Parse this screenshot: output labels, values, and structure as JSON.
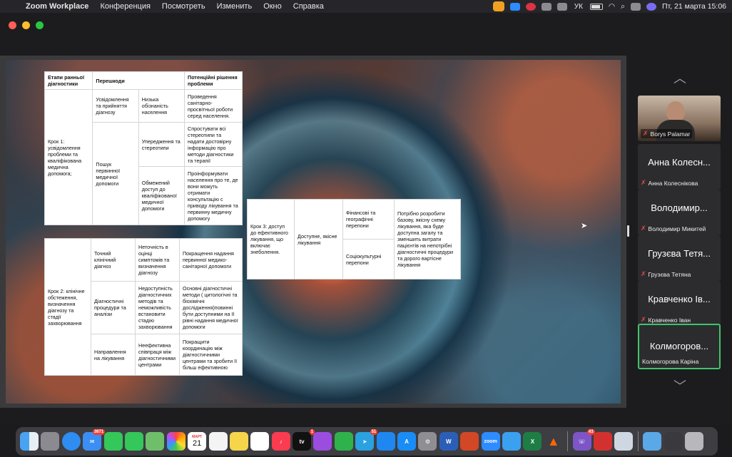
{
  "menubar": {
    "app_name": "Zoom Workplace",
    "items": [
      "Конференция",
      "Посмотреть",
      "Изменить",
      "Окно",
      "Справка"
    ],
    "keyboard_layout": "УК",
    "datetime": "Пт, 21 марта  15:06"
  },
  "slide": {
    "table1": {
      "headers": [
        "Етапи ранньої діагностики",
        "Перешкоди",
        "Потенційні рішення проблеми"
      ],
      "step": "Крок 1: усвідомлення проблеми та кваліфікована медична допомога;",
      "obstacle_a": "Усвідомлення та прийняття діагнозу",
      "obstacle_b": "Пошук первинної медичної допомоги",
      "rows": [
        {
          "reason": "Низька обізнаність населення",
          "solution": "Проведення санітарно-просвітньої роботи серед населення."
        },
        {
          "reason": "Упередження та стереотипи",
          "solution": "Спростувати всі стереотипи та надати достовірну інформацію про методи діагностики та терапії"
        },
        {
          "reason": "Обмежений доступ до кваліфікованої медичної допомоги",
          "solution": "Проінформувати населення про те, де вони можуть отримати консультацію с приводу лікування та первинну медичну допомогу"
        }
      ]
    },
    "table2": {
      "step": "Крок 2: клінічне обстеження, визначення діагнозу та стадії захворювання",
      "rows": [
        {
          "obstacle": "Точний клінічний діагноз",
          "reason": "Неточність в оцінці симптомів та визначення діагнозу",
          "solution": "Покращення надання первинної медико-санітарної допомоги"
        },
        {
          "obstacle": "Діагностичні процедури та аналізи",
          "reason": "Недоступність діагностичних методів та неможливість встановити стадію захворювання",
          "solution": "Основні діагностичні методи ( цитологічні та біохімічні дослідження)повинні бути доступними на II рівні надання медичної допомоги"
        },
        {
          "obstacle": "Направлення на лікування",
          "reason": "Неефективна співпраця між діагностичними центрами",
          "solution": "Покращити координацію між діагностичними центрами та зробити її більш ефективною"
        }
      ]
    },
    "table3": {
      "step": "Крок 3: доступ до ефективного лікування, що включає знеболення.",
      "obstacle": "Доступне, якісне лікування",
      "reason_a": "Фінансові та географічні перепони",
      "reason_b": "Соціокультурні перепони",
      "solution": "Потрібно розробити базову, якісну схему лікування, яка буде доступна загалу та зменшить витрати пацієнтів на непотрібні діагностичні процедури та дорого вартісне лікування"
    }
  },
  "participants": [
    {
      "display": "",
      "name": "Borys Palamar",
      "video": true
    },
    {
      "display": "Анна Колесн...",
      "name": "Анна Колеснікова"
    },
    {
      "display": "Володимир...",
      "name": "Володимир Микитей"
    },
    {
      "display": "Грузєва Тетя...",
      "name": "Грузєва Тетяна"
    },
    {
      "display": "Кравченко Ів...",
      "name": "Кравченко Іван"
    },
    {
      "display": "Колмогоров...",
      "name": "Колмогорова Каріна",
      "active": true
    }
  ],
  "dock": {
    "calendar_month": "МАРТ",
    "calendar_day": "21",
    "mail_badge": "3871",
    "tv_badge": "1",
    "telegram_badge": "51",
    "viber_badge": "43",
    "zoom_label": "zoom",
    "word_label": "W",
    "excel_label": "X"
  },
  "colors": {
    "active_speaker": "#3fc46a",
    "mic_off": "#e8474b",
    "menubar_bg": "#26262a"
  }
}
